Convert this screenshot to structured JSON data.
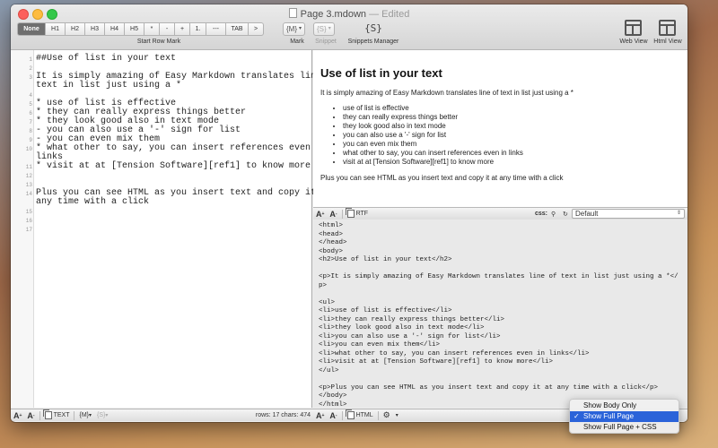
{
  "window": {
    "title": "Page 3.mdown",
    "status": " — Edited"
  },
  "toolbar": {
    "headings": [
      "None",
      "H1",
      "H2",
      "H3",
      "H4",
      "H5"
    ],
    "format_buttons": [
      "*",
      "-",
      "+",
      "1.",
      "---",
      "TAB",
      ">"
    ],
    "start_row_label": "Start Row Mark",
    "mark_button": "{M}",
    "mark_label": "Mark",
    "snippet_button": "{S}",
    "snippet_label": "Snippet",
    "snippets_manager_icon": "{S}",
    "snippets_manager_label": "Snippets Manager",
    "web_view_label": "Web View",
    "html_view_label": "Html View"
  },
  "editor": {
    "lines": [
      "##Use of list in your text",
      "",
      "It is simply amazing of Easy Markdown translates line of",
      "text in list just using a *",
      "",
      "* use of list is effective",
      "* they can really express things better",
      "* they look good also in text mode",
      "- you can also use a '-' sign for list",
      "- you can even mix them",
      "* what other to say, you can insert references even in",
      "links",
      "* visit at at [Tension Software][ref1] to know more",
      "",
      "",
      "Plus you can see HTML as you insert text and copy it at",
      "any time with a click"
    ],
    "line_numbers": [
      "1",
      "2",
      "3",
      "",
      "4",
      "5",
      "6",
      "7",
      "8",
      "9",
      "10",
      "",
      "11",
      "12",
      "13",
      "14",
      "",
      "15",
      "16",
      "17"
    ],
    "footer": {
      "text_button": "TEXT",
      "mark_button": "{M}",
      "snippet_button": "{S}",
      "stats": "rows: 17 chars: 474"
    }
  },
  "preview": {
    "heading": "Use of list in your text",
    "intro": "It is simply amazing of Easy Markdown translates line of text in list just using a *",
    "items": [
      "use of list is effective",
      "they can really express things better",
      "they look good also in text mode",
      "you can also use a '-' sign for list",
      "you can even mix them",
      "what other to say, you can insert references even in links",
      "visit at at [Tension Software][ref1] to know more"
    ],
    "outro": "Plus you can see HTML as you insert text and copy it at any time with a click"
  },
  "preview_bar": {
    "rtf_button": "RTF",
    "css_label": "css:",
    "css_value": "Default"
  },
  "source": {
    "lines": [
      "<html>",
      "<head>",
      "</head>",
      "<body>",
      "<h2>Use of list in your text</h2>",
      "",
      "<p>It is simply amazing of Easy Markdown translates line of text in list just using a *</",
      "p>",
      "",
      "<ul>",
      "<li>use of list is effective</li>",
      "<li>they can really express things better</li>",
      "<li>they look good also in text mode</li>",
      "<li>you can also use a '-' sign for list</li>",
      "<li>you can even mix them</li>",
      "<li>what other to say, you can insert references even in links</li>",
      "<li>visit at at [Tension Software][ref1] to know more</li>",
      "</ul>",
      "",
      "<p>Plus you can see HTML as you insert text and copy it at any time with a click</p>",
      "</body>",
      "</html>"
    ]
  },
  "source_bar": {
    "html_button": "HTML"
  },
  "dropdown_menu": {
    "items": [
      "Show Body Only",
      "Show Full Page",
      "Show Full Page + CSS"
    ],
    "selected_index": 1
  }
}
